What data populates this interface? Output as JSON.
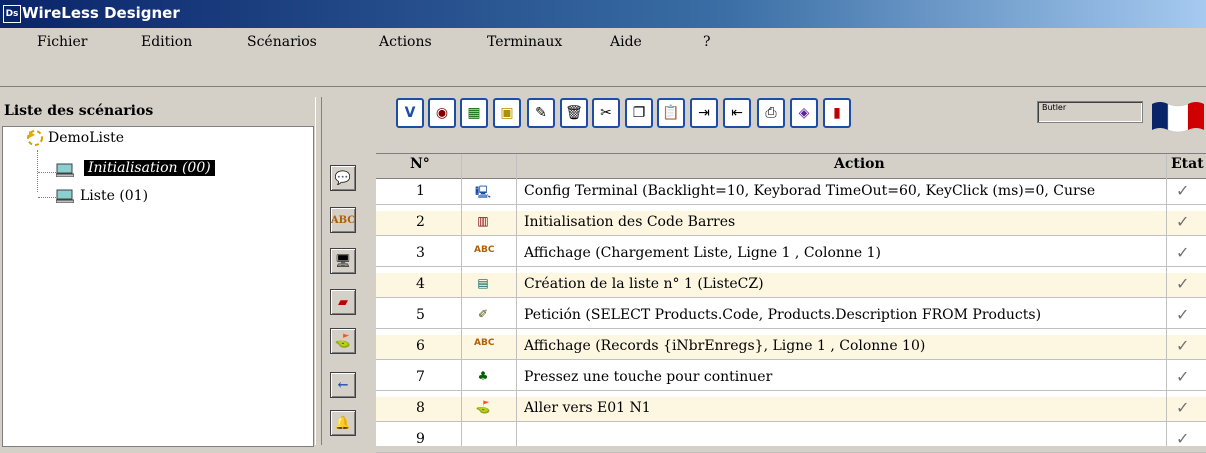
{
  "window": {
    "title": "WireLess Designer",
    "logo_text": "Ds"
  },
  "menu": [
    {
      "label": "Fichier"
    },
    {
      "label": "Edition"
    },
    {
      "label": "Scénarios"
    },
    {
      "label": "Actions"
    },
    {
      "label": "Terminaux"
    },
    {
      "label": "Aide"
    },
    {
      "label": "?"
    }
  ],
  "scenario_panel": {
    "header": "Liste des scénarios",
    "root": "DemoListe",
    "items": [
      {
        "label": "Initialisation (00)",
        "selected": true
      },
      {
        "label": "Liste (01)",
        "selected": false
      }
    ]
  },
  "toolbar": {
    "buttons": [
      "V",
      "shield-icon",
      "chart-icon",
      "folder-icon",
      "edit-icon",
      "trash-icon",
      "scissors-icon",
      "copy-icon",
      "paste-icon",
      "indent-icon",
      "outdent-icon",
      "print-icon",
      "book-icon",
      "color-icon"
    ],
    "butler_label": "Butler"
  },
  "side_buttons": [
    "comment-icon",
    "abc-icon",
    "terminal-icon",
    "eraser-icon",
    "signpost-icon",
    "arrow-left-icon",
    "bell-icon"
  ],
  "grid": {
    "columns": {
      "num": "N°",
      "action": "Action",
      "state": "Etat"
    },
    "rows": [
      {
        "num": "1",
        "icon": "terminal-icon",
        "action": "Config Terminal (Backlight=10, Keyborad TimeOut=60, KeyClick (ms)=0, Curse",
        "done": true
      },
      {
        "num": "2",
        "icon": "barcode-icon",
        "action": "Initialisation des Code Barres",
        "done": true
      },
      {
        "num": "3",
        "icon": "abc-icon",
        "action": "Affichage (Chargement Liste, Ligne 1 , Colonne 1)",
        "done": true
      },
      {
        "num": "4",
        "icon": "list-icon",
        "action": "Création de la liste n° 1 (ListeCZ)",
        "done": true
      },
      {
        "num": "5",
        "icon": "request-icon",
        "action": "Petición (SELECT Products.Code, Products.Description FROM Products)",
        "done": true
      },
      {
        "num": "6",
        "icon": "abc-icon",
        "action": "Affichage (Records {iNbrEnregs}, Ligne 1 , Colonne 10)",
        "done": true
      },
      {
        "num": "7",
        "icon": "palm-icon",
        "action": "Pressez une touche pour continuer",
        "done": true
      },
      {
        "num": "8",
        "icon": "signpost-icon",
        "action": "Aller vers E01 N1",
        "done": true
      },
      {
        "num": "9",
        "icon": "",
        "action": "",
        "done": true
      }
    ]
  }
}
